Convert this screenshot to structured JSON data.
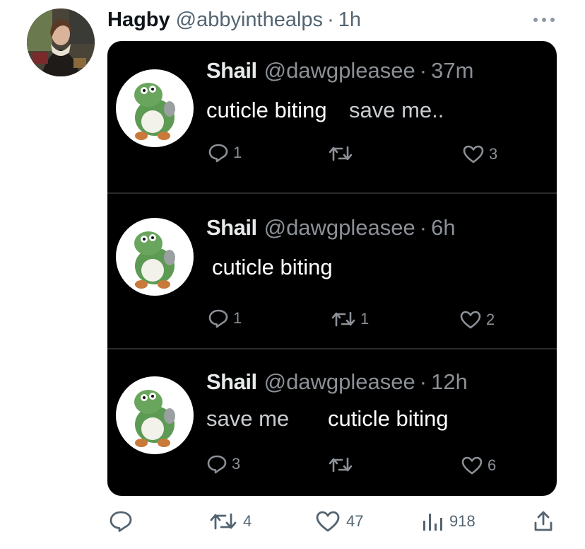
{
  "tweet": {
    "display_name": "Hagby",
    "handle": "@abbyinthealps",
    "separator": "·",
    "time": "1h",
    "more_icon": "more-horizontal-icon"
  },
  "embedded_image": {
    "tweets": [
      {
        "name": "Shail",
        "handle": "@dawgpleasee",
        "separator": "·",
        "time": "37m",
        "text_part1": "cuticle biting",
        "text_part2": "save me..",
        "replies": "1",
        "retweets": "",
        "likes": "3"
      },
      {
        "name": "Shail",
        "handle": "@dawgpleasee",
        "separator": "·",
        "time": "6h",
        "text_part1": "cuticle biting",
        "text_part2": "",
        "replies": "1",
        "retweets": "1",
        "likes": "2"
      },
      {
        "name": "Shail",
        "handle": "@dawgpleasee",
        "separator": "·",
        "time": "12h",
        "text_part1": "save me",
        "text_part2": "cuticle biting",
        "replies": "3",
        "retweets": "",
        "likes": "6"
      }
    ]
  },
  "actions": {
    "reply_count": "",
    "retweet_count": "4",
    "like_count": "47",
    "view_count": "918"
  },
  "colors": {
    "text_primary": "#0f1419",
    "text_secondary": "#536471",
    "media_background": "#000000"
  }
}
